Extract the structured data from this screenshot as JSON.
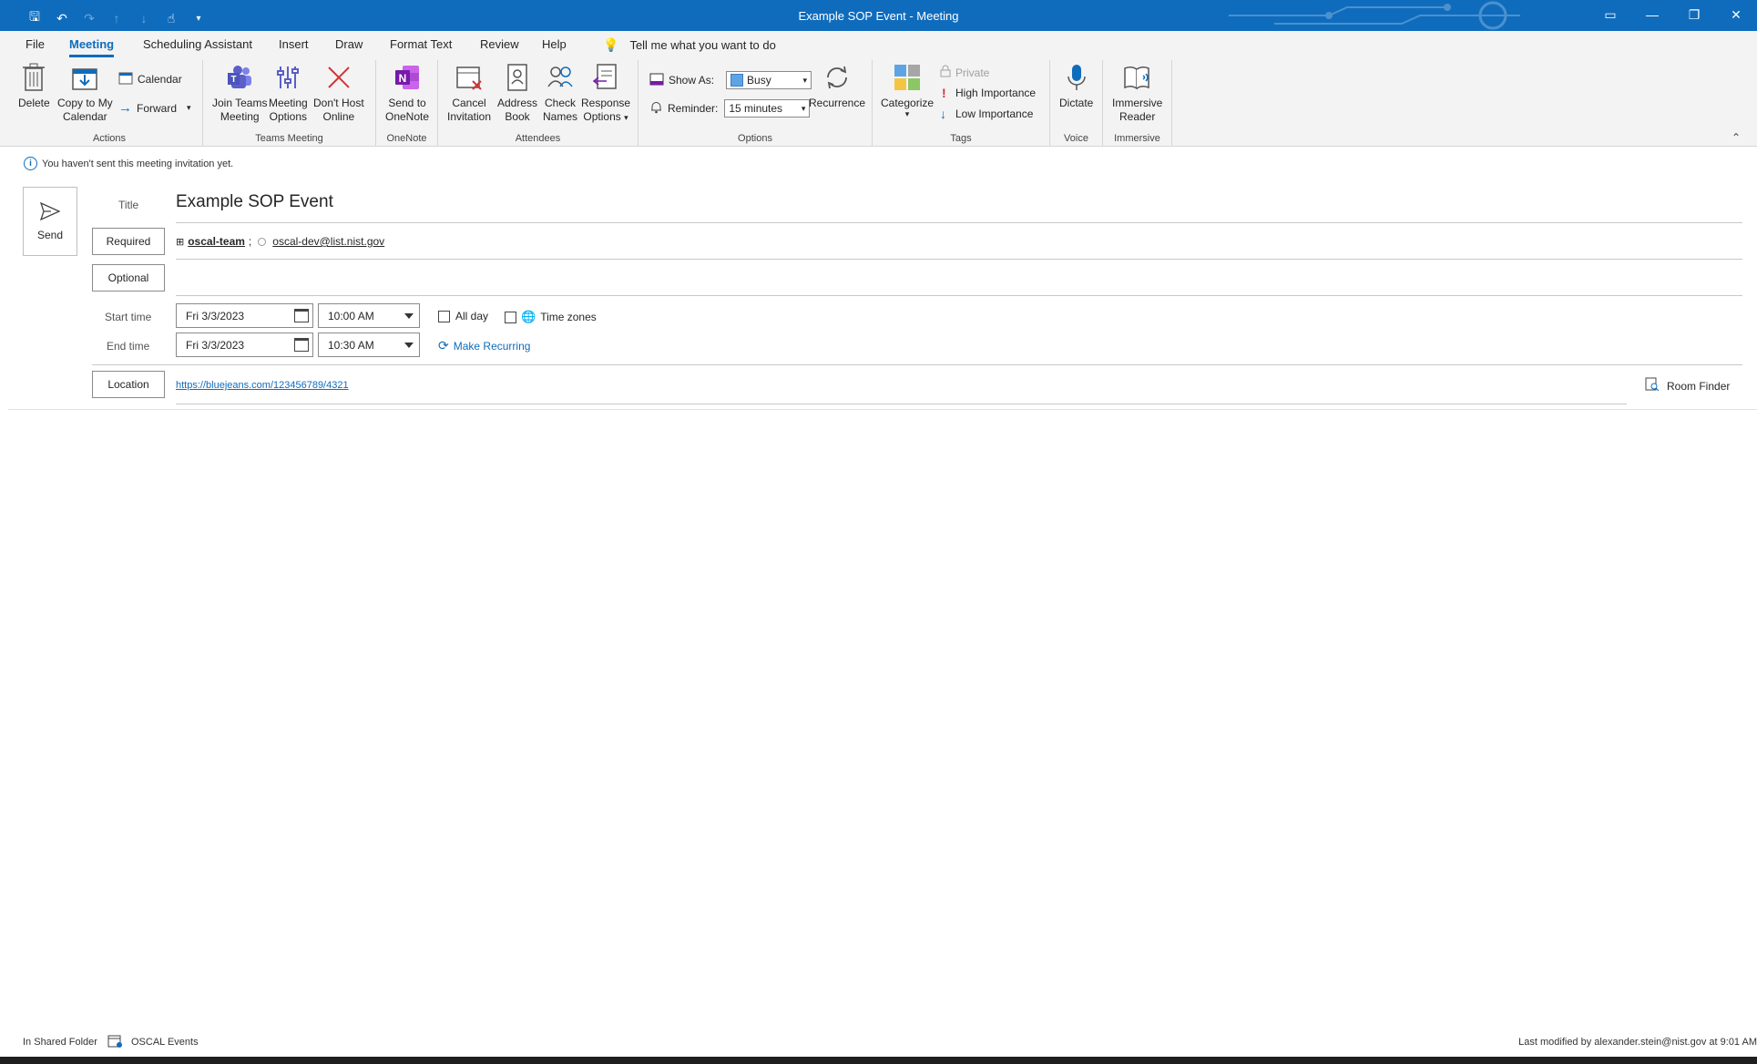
{
  "window": {
    "title": "Example SOP Event  -  Meeting",
    "qat_icons": [
      "save-icon",
      "undo-icon",
      "redo-icon",
      "up-arrow-icon",
      "down-arrow-icon",
      "touch-mode-icon",
      "customize-icon"
    ],
    "controls": [
      "ribbon-display-icon",
      "minimize-icon",
      "restore-icon",
      "close-icon"
    ]
  },
  "menu": {
    "items": [
      "File",
      "Meeting",
      "Scheduling Assistant",
      "Insert",
      "Draw",
      "Format Text",
      "Review",
      "Help"
    ],
    "active": "Meeting",
    "tell_me": "Tell me what you want to do"
  },
  "ribbon": {
    "actions": {
      "label": "Actions",
      "delete": "Delete",
      "copy1": "Copy to My",
      "copy2": "Calendar",
      "calendar": "Calendar",
      "forward": "Forward"
    },
    "teams": {
      "label": "Teams Meeting",
      "join1": "Join Teams",
      "join2": "Meeting",
      "opts1": "Meeting",
      "opts2": "Options",
      "dont1": "Don't Host",
      "dont2": "Online"
    },
    "onenote": {
      "label": "OneNote",
      "send1": "Send to",
      "send2": "OneNote"
    },
    "attendees": {
      "label": "Attendees",
      "cancel1": "Cancel",
      "cancel2": "Invitation",
      "addr1": "Address",
      "addr2": "Book",
      "check1": "Check",
      "check2": "Names",
      "resp1": "Response",
      "resp2": "Options"
    },
    "options": {
      "label": "Options",
      "show_as_label": "Show As:",
      "show_as_value": "Busy",
      "reminder_label": "Reminder:",
      "reminder_value": "15 minutes",
      "recurrence": "Recurrence"
    },
    "tags": {
      "label": "Tags",
      "categorize": "Categorize",
      "private": "Private",
      "high": "High Importance",
      "low": "Low Importance"
    },
    "voice": {
      "label": "Voice",
      "dictate": "Dictate"
    },
    "immersive": {
      "label": "Immersive",
      "reader1": "Immersive",
      "reader2": "Reader"
    }
  },
  "info": {
    "message": "You haven't sent this meeting invitation yet."
  },
  "form": {
    "send": "Send",
    "title_label": "Title",
    "title_value": "Example SOP Event",
    "required_label": "Required",
    "required_group": "oscal-team",
    "required_sep": ";",
    "required_email": "oscal-dev@list.nist.gov",
    "optional_label": "Optional",
    "start_label": "Start time",
    "start_date": "Fri 3/3/2023",
    "start_time": "10:00 AM",
    "end_label": "End time",
    "end_date": "Fri 3/3/2023",
    "end_time": "10:30 AM",
    "all_day": "All day",
    "time_zones": "Time zones",
    "make_recurring": "Make Recurring",
    "location_label": "Location",
    "location_value": "https://bluejeans.com/123456789/4321",
    "room_finder": "Room Finder"
  },
  "footer": {
    "folder_label": "In Shared Folder",
    "folder_name": "OSCAL Events",
    "modified": "Last modified by alexander.stein@nist.gov at 9:01 AM"
  },
  "colors": {
    "accent": "#0f6cbd",
    "ribbon_bg": "#f3f3f3",
    "delete_red": "#d13438",
    "onenote_purple": "#7719aa",
    "teams_purple": "#5b5fc7"
  }
}
